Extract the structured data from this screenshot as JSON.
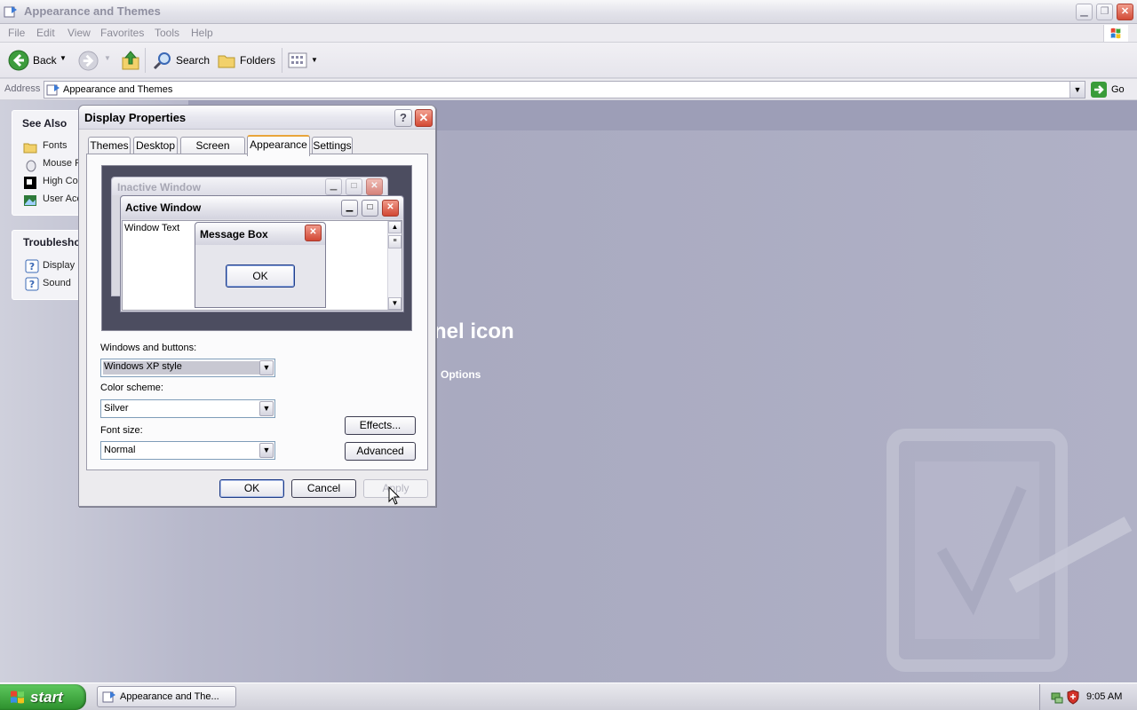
{
  "window": {
    "title": "Appearance and Themes"
  },
  "menu": [
    "File",
    "Edit",
    "View",
    "Favorites",
    "Tools",
    "Help"
  ],
  "toolbar": {
    "back": "Back",
    "search": "Search",
    "folders": "Folders"
  },
  "address": {
    "label": "Address",
    "value": "Appearance and Themes",
    "go": "Go"
  },
  "sidebar": {
    "see_also_title": "See Also",
    "see_also": [
      "Fonts",
      "Mouse P",
      "High Cor",
      "User Acc"
    ],
    "troubleshoot_title": "Troubleshoo",
    "troubleshoot": [
      "Display",
      "Sound"
    ]
  },
  "main": {
    "heading_partial": "nel icon",
    "options_link": "Options"
  },
  "dialog": {
    "title": "Display Properties",
    "help_glyph": "?",
    "close_glyph": "✕",
    "tabs": [
      "Themes",
      "Desktop",
      "Screen Saver",
      "Appearance",
      "Settings"
    ],
    "active_tab": "Appearance",
    "preview": {
      "inactive_title": "Inactive Window",
      "active_title": "Active Window",
      "window_text": "Window Text",
      "message_box_title": "Message Box",
      "message_box_ok": "OK"
    },
    "windows_buttons_label": "Windows and buttons:",
    "windows_buttons_value": "Windows XP style",
    "color_scheme_label": "Color scheme:",
    "color_scheme_value": "Silver",
    "font_size_label": "Font size:",
    "font_size_value": "Normal",
    "effects": "Effects...",
    "advanced": "Advanced",
    "ok": "OK",
    "cancel": "Cancel",
    "apply": "Apply"
  },
  "taskbar": {
    "start": "start",
    "task_button": "Appearance and The...",
    "clock": "9:05 AM"
  },
  "colors": {
    "accent": "#e9a53a",
    "start_green": "#3ea83e",
    "close_red": "#d44a35"
  }
}
